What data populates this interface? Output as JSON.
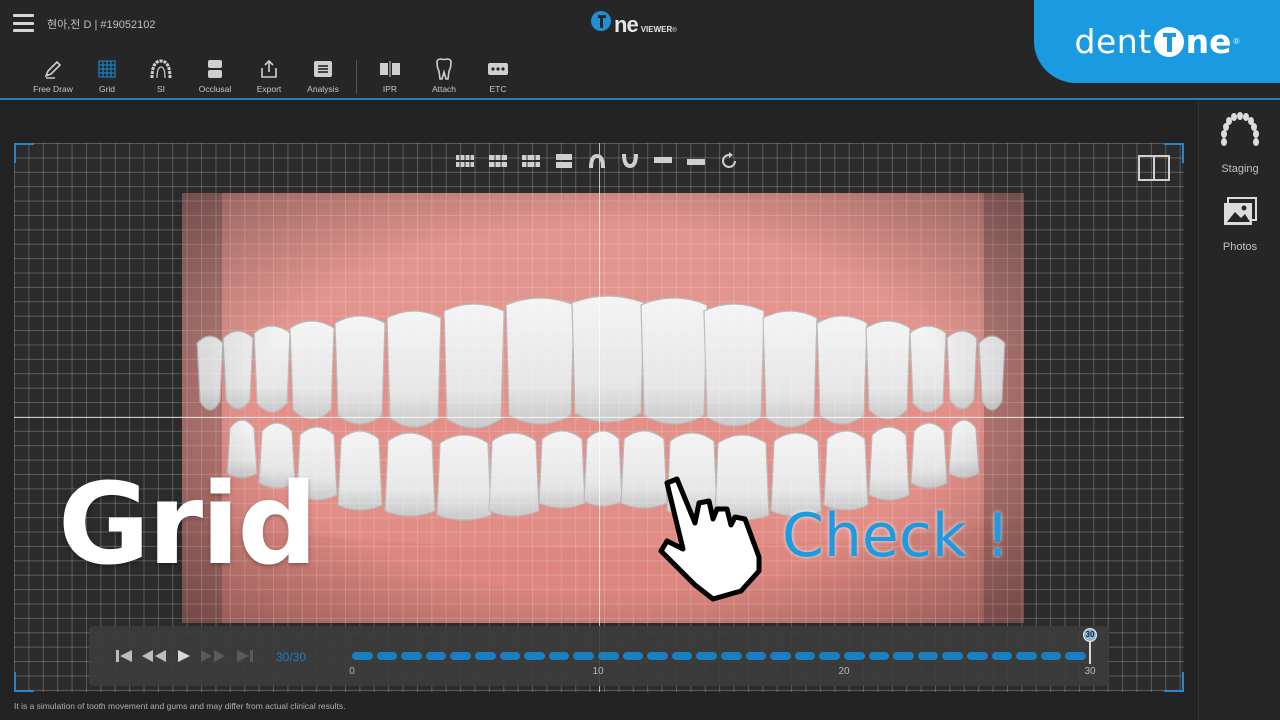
{
  "header": {
    "patient": "현아,전 D | #19052102",
    "viewer_logo_main": "ne",
    "viewer_logo_sub": "VIEWER",
    "brand_text": "dent",
    "brand_suffix": "ne"
  },
  "toolbar": {
    "tools": [
      {
        "label": "Free Draw",
        "icon": "pencil-icon"
      },
      {
        "label": "Grid",
        "icon": "grid-icon"
      },
      {
        "label": "SI",
        "icon": "arch-icon"
      },
      {
        "label": "Occlusal",
        "icon": "occlusal-icon"
      },
      {
        "label": "Export",
        "icon": "export-icon"
      },
      {
        "label": "Analysis",
        "icon": "analysis-icon"
      },
      {
        "label": "IPR",
        "icon": "ipr-icon"
      },
      {
        "label": "Attach",
        "icon": "tooth-icon"
      },
      {
        "label": "ETC",
        "icon": "more-icon"
      }
    ]
  },
  "right_panel": {
    "staging_label": "Staging",
    "photos_label": "Photos"
  },
  "overlay": {
    "title": "Grid",
    "callout": "Check !"
  },
  "playback": {
    "frame_count": "30/30",
    "current_frame": "30",
    "total_frames": 30,
    "ticks": [
      "0",
      "10",
      "20",
      "30"
    ]
  },
  "footer": {
    "disclaimer": "It is a simulation of tooth movement and gums and may differ from actual clinical results."
  },
  "colors": {
    "accent": "#1a9ae0",
    "track": "#1a7fc2",
    "gum": "#e7938d",
    "background": "#232323"
  }
}
